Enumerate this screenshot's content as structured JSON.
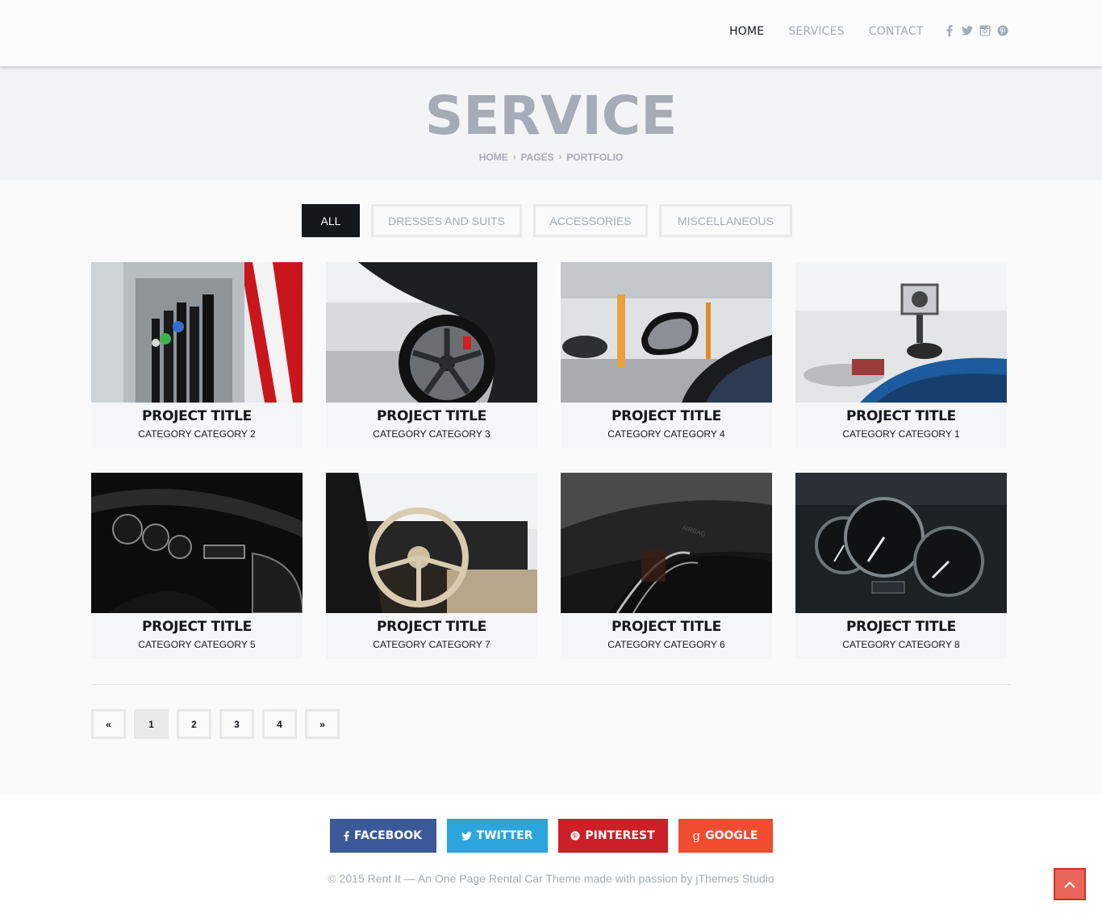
{
  "nav": {
    "items": [
      {
        "label": "HOME",
        "active": true
      },
      {
        "label": "SERVICES",
        "active": false
      },
      {
        "label": "CONTACT",
        "active": false
      }
    ],
    "socials": [
      "facebook-icon",
      "twitter-icon",
      "instagram-icon",
      "pinterest-icon"
    ]
  },
  "page": {
    "title": "SERVICE",
    "breadcrumb": [
      "HOME",
      "PAGES",
      "PORTFOLIO"
    ]
  },
  "filters": [
    {
      "label": "ALL",
      "active": true
    },
    {
      "label": "DRESSES AND SUITS",
      "active": false
    },
    {
      "label": "ACCESSORIES",
      "active": false
    },
    {
      "label": "MISCELLANEOUS",
      "active": false
    }
  ],
  "projects": [
    {
      "title": "PROJECT TITLE",
      "category": "CATEGORY CATEGORY 2",
      "image": "fuel-pump"
    },
    {
      "title": "PROJECT TITLE",
      "category": "CATEGORY CATEGORY 3",
      "image": "car-wheel"
    },
    {
      "title": "PROJECT TITLE",
      "category": "CATEGORY CATEGORY 4",
      "image": "side-mirror"
    },
    {
      "title": "PROJECT TITLE",
      "category": "CATEGORY CATEGORY 1",
      "image": "action-camera"
    },
    {
      "title": "PROJECT TITLE",
      "category": "CATEGORY CATEGORY 5",
      "image": "dashboard-dials"
    },
    {
      "title": "PROJECT TITLE",
      "category": "CATEGORY CATEGORY 7",
      "image": "steering-wheel"
    },
    {
      "title": "PROJECT TITLE",
      "category": "CATEGORY CATEGORY 6",
      "image": "airbag-dashboard"
    },
    {
      "title": "PROJECT TITLE",
      "category": "CATEGORY CATEGORY 8",
      "image": "speedometer"
    }
  ],
  "pagination": {
    "prev": "«",
    "pages": [
      "1",
      "2",
      "3",
      "4"
    ],
    "current": "1",
    "next": "»"
  },
  "footer": {
    "share": [
      {
        "label": "FACEBOOK",
        "icon": "facebook-icon",
        "color": "#3b5998"
      },
      {
        "label": "TWITTER",
        "icon": "twitter-icon",
        "color": "#2ba5dc"
      },
      {
        "label": "PINTEREST",
        "icon": "pinterest-icon",
        "color": "#cb2027"
      },
      {
        "label": "GOOGLE",
        "icon": "google-icon",
        "color": "#f14b30"
      }
    ],
    "copyright": "© 2015 Rent It — An One Page Rental Car Theme made with passion by jThemes Studio"
  },
  "colors": {
    "dark": "#14171c",
    "muted": "#a5abb7",
    "border": "#e9e9e9",
    "scroll_top": "#e8665a"
  }
}
